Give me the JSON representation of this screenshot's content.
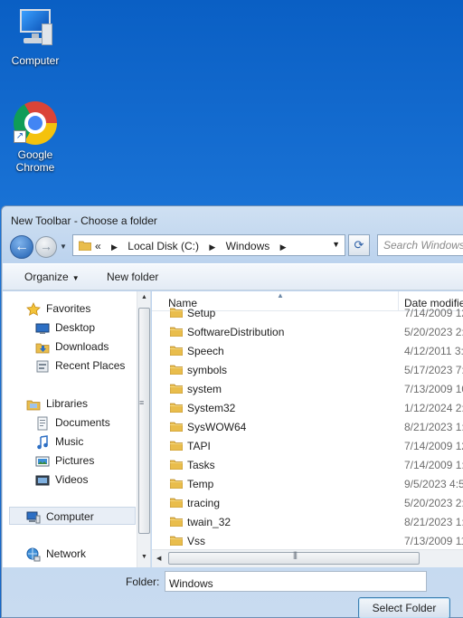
{
  "desktop": {
    "icons": [
      {
        "label": "Computer",
        "icon": "computer-icon"
      },
      {
        "label": "Google\nChrome",
        "label_line1": "Google",
        "label_line2": "Chrome",
        "icon": "chrome-icon"
      }
    ]
  },
  "dialog": {
    "title": "New Toolbar - Choose a folder",
    "address": {
      "prefix": "«",
      "crumbs": [
        "Local Disk (C:)",
        "Windows"
      ]
    },
    "search_placeholder": "Search Windows",
    "toolbar": {
      "organize_label": "Organize",
      "new_folder_label": "New folder"
    },
    "nav_pane": {
      "favorites": {
        "label": "Favorites",
        "items": [
          "Desktop",
          "Downloads",
          "Recent Places"
        ]
      },
      "libraries": {
        "label": "Libraries",
        "items": [
          "Documents",
          "Music",
          "Pictures",
          "Videos"
        ]
      },
      "computer": "Computer",
      "network": "Network"
    },
    "file_list": {
      "columns": {
        "name": "Name",
        "date": "Date modifie"
      },
      "rows": [
        {
          "name": "Setup",
          "date": "7/14/2009 12"
        },
        {
          "name": "SoftwareDistribution",
          "date": "5/20/2023 2:2"
        },
        {
          "name": "Speech",
          "date": "4/12/2011 3:3"
        },
        {
          "name": "symbols",
          "date": "5/17/2023 7:3"
        },
        {
          "name": "system",
          "date": "7/13/2009 10"
        },
        {
          "name": "System32",
          "date": "1/12/2024 2:1"
        },
        {
          "name": "SysWOW64",
          "date": "8/21/2023 1:0"
        },
        {
          "name": "TAPI",
          "date": "7/14/2009 12"
        },
        {
          "name": "Tasks",
          "date": "7/14/2009 1:0"
        },
        {
          "name": "Temp",
          "date": "9/5/2023 4:54"
        },
        {
          "name": "tracing",
          "date": "5/20/2023 2:2"
        },
        {
          "name": "twain_32",
          "date": "8/21/2023 1:0"
        },
        {
          "name": "Vss",
          "date": "7/13/2009 11"
        }
      ]
    },
    "folder_field": {
      "label": "Folder:",
      "value": "Windows"
    },
    "select_button": "Select Folder"
  }
}
